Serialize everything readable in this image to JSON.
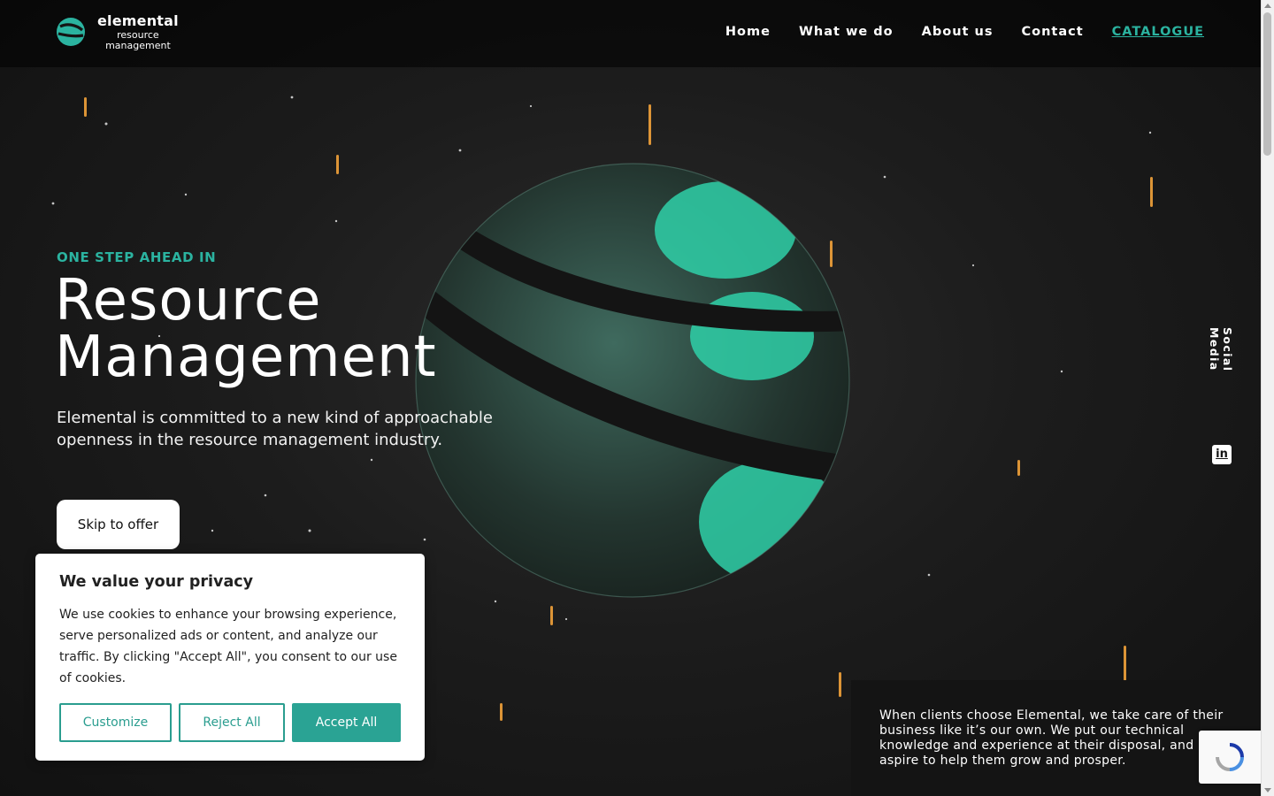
{
  "brand": {
    "line1": "elemental",
    "line2": "resource",
    "line3": "management",
    "accent_color": "#2bb3a0"
  },
  "nav": {
    "items": [
      {
        "label": "Home"
      },
      {
        "label": "What we do"
      },
      {
        "label": "About us"
      },
      {
        "label": "Contact"
      },
      {
        "label": "CATALOGUE"
      }
    ]
  },
  "hero": {
    "eyebrow": "ONE STEP AHEAD IN",
    "title_line1": "Resource",
    "title_line2": "Management",
    "subtitle": "Elemental is committed to a new kind of approachable openness in the resource management industry.",
    "cta_label": "Skip to offer"
  },
  "social": {
    "label": "Social Media",
    "linkedin_icon": "linkedin-icon",
    "linkedin_glyph": "in"
  },
  "info": {
    "text": "When clients choose Elemental, we take care of their business like it’s our own. We put our technical knowledge and experience at their disposal, and aspire to help them grow and prosper."
  },
  "cookie": {
    "title": "We value your privacy",
    "body": "We use cookies to enhance your browsing experience, serve personalized ads or content, and analyze our traffic. By clicking \"Accept All\", you consent to our use of cookies.",
    "customize_label": "Customize",
    "reject_label": "Reject All",
    "accept_label": "Accept All",
    "button_color": "#2aa394"
  }
}
